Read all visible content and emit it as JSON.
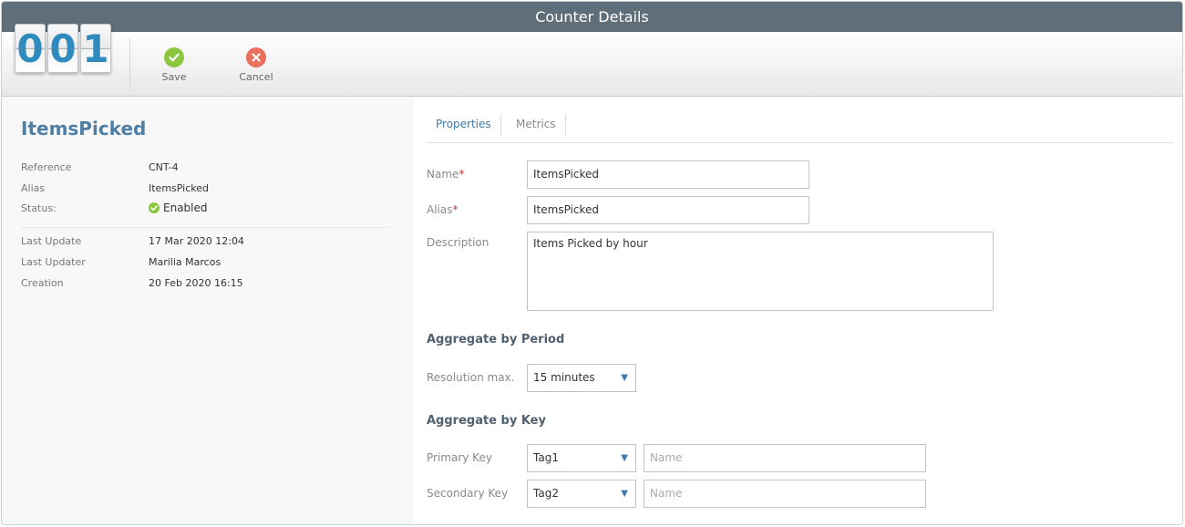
{
  "window": {
    "title": "Counter Details"
  },
  "logo": {
    "digits": [
      "0",
      "0",
      "1"
    ]
  },
  "toolbar": {
    "save_label": "Save",
    "cancel_label": "Cancel"
  },
  "summary": {
    "title": "ItemsPicked",
    "fields": [
      {
        "label": "Reference",
        "value": "CNT-4"
      },
      {
        "label": "Alias",
        "value": "ItemsPicked"
      },
      {
        "label": "Status:",
        "value": "Enabled"
      }
    ],
    "audit": [
      {
        "label": "Last Update",
        "value": "17 Mar 2020 12:04"
      },
      {
        "label": "Last Updater",
        "value": "Marilia Marcos"
      },
      {
        "label": "Creation",
        "value": "20 Feb 2020 16:15"
      }
    ]
  },
  "tabs": [
    {
      "label": "Properties",
      "active": true
    },
    {
      "label": "Metrics",
      "active": false
    }
  ],
  "form": {
    "name": {
      "label": "Name",
      "required_mark": "*",
      "value": "ItemsPicked"
    },
    "alias": {
      "label": "Alias",
      "required_mark": "*",
      "value": "ItemsPicked"
    },
    "description": {
      "label": "Description",
      "value": "Items Picked by hour"
    },
    "period_section": "Aggregate by Period",
    "resolution": {
      "label": "Resolution max.",
      "value": "15 minutes"
    },
    "key_section": "Aggregate by Key",
    "primary_key": {
      "label": "Primary Key",
      "value": "Tag1",
      "name_placeholder": "Name"
    },
    "secondary_key": {
      "label": "Secondary Key",
      "value": "Tag2",
      "name_placeholder": "Name"
    }
  },
  "colors": {
    "titlebar": "#5f6e79",
    "accent": "#3e78a8",
    "ok": "#8cc63f",
    "cancel": "#e8705c",
    "title_text": "#4f7fa5"
  },
  "icons": {
    "save": "check-circle-icon",
    "cancel": "x-circle-icon",
    "status": "check-circle-icon",
    "dropdown": "chevron-down-icon"
  }
}
